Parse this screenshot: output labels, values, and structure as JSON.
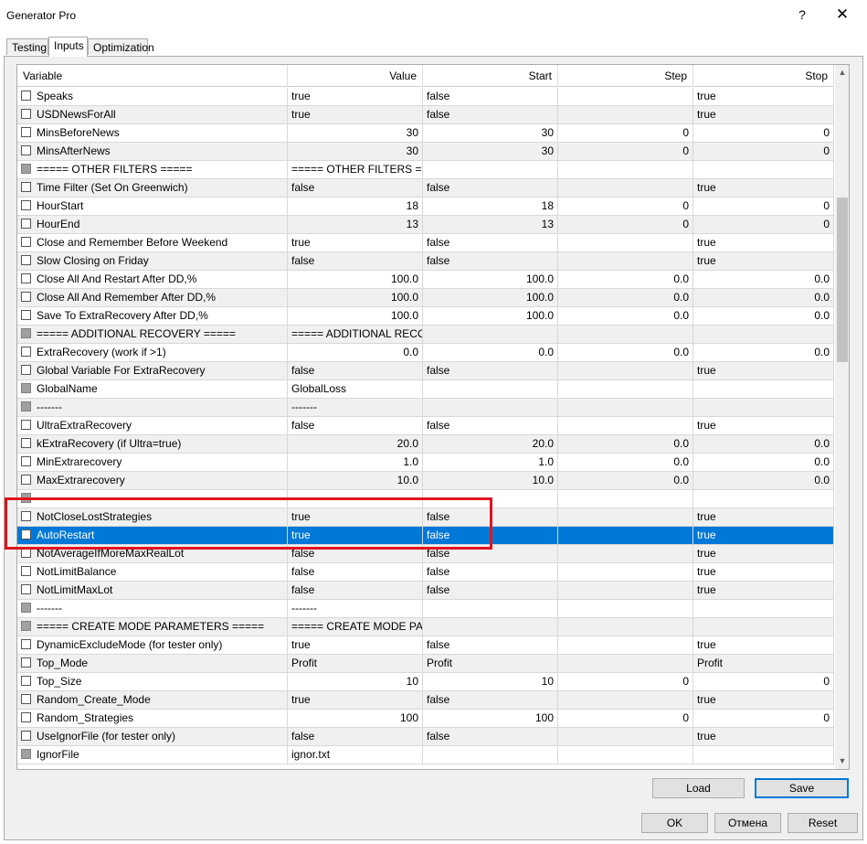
{
  "window": {
    "title": "Generator Pro",
    "help_label": "?",
    "close_label": "✕"
  },
  "tabs": [
    {
      "label": "Testing",
      "active": false
    },
    {
      "label": "Inputs",
      "active": true
    },
    {
      "label": "Optimization",
      "active": false
    }
  ],
  "grid": {
    "headers": {
      "variable": "Variable",
      "value": "Value",
      "start": "Start",
      "step": "Step",
      "stop": "Stop"
    },
    "rows": [
      {
        "name": "Speaks",
        "value": "true",
        "start": "false",
        "step": "",
        "stop": "true",
        "checkbox": "normal",
        "numeric": false
      },
      {
        "name": "USDNewsForAll",
        "value": "true",
        "start": "false",
        "step": "",
        "stop": "true",
        "checkbox": "normal",
        "numeric": false
      },
      {
        "name": "MinsBeforeNews",
        "value": "30",
        "start": "30",
        "step": "0",
        "stop": "0",
        "checkbox": "normal",
        "numeric": true
      },
      {
        "name": "MinsAfterNews",
        "value": "30",
        "start": "30",
        "step": "0",
        "stop": "0",
        "checkbox": "normal",
        "numeric": true
      },
      {
        "name": "=====     OTHER FILTERS     =====",
        "value": "=====     OTHER FILTERS     =====",
        "start": "",
        "step": "",
        "stop": "",
        "checkbox": "disabled",
        "numeric": false
      },
      {
        "name": "Time Filter (Set On Greenwich)",
        "value": "false",
        "start": "false",
        "step": "",
        "stop": "true",
        "checkbox": "normal",
        "numeric": false
      },
      {
        "name": "HourStart",
        "value": "18",
        "start": "18",
        "step": "0",
        "stop": "0",
        "checkbox": "normal",
        "numeric": true
      },
      {
        "name": "HourEnd",
        "value": "13",
        "start": "13",
        "step": "0",
        "stop": "0",
        "checkbox": "normal",
        "numeric": true
      },
      {
        "name": "Close and Remember Before Weekend",
        "value": "true",
        "start": "false",
        "step": "",
        "stop": "true",
        "checkbox": "normal",
        "numeric": false
      },
      {
        "name": "Slow Closing on Friday",
        "value": "false",
        "start": "false",
        "step": "",
        "stop": "true",
        "checkbox": "normal",
        "numeric": false
      },
      {
        "name": "Close All And Restart After DD,%",
        "value": "100.0",
        "start": "100.0",
        "step": "0.0",
        "stop": "0.0",
        "checkbox": "normal",
        "numeric": true
      },
      {
        "name": "Close All And Remember After DD,%",
        "value": "100.0",
        "start": "100.0",
        "step": "0.0",
        "stop": "0.0",
        "checkbox": "normal",
        "numeric": true
      },
      {
        "name": "Save To ExtraRecovery After DD,%",
        "value": "100.0",
        "start": "100.0",
        "step": "0.0",
        "stop": "0.0",
        "checkbox": "normal",
        "numeric": true
      },
      {
        "name": "===== ADDITIONAL RECOVERY =====",
        "value": "===== ADDITIONAL RECOVERY =====",
        "start": "",
        "step": "",
        "stop": "",
        "checkbox": "disabled",
        "numeric": false
      },
      {
        "name": "ExtraRecovery (work if >1)",
        "value": "0.0",
        "start": "0.0",
        "step": "0.0",
        "stop": "0.0",
        "checkbox": "normal",
        "numeric": true
      },
      {
        "name": "Global Variable For ExtraRecovery",
        "value": "false",
        "start": "false",
        "step": "",
        "stop": "true",
        "checkbox": "normal",
        "numeric": false
      },
      {
        "name": "GlobalName",
        "value": "GlobalLoss",
        "start": "",
        "step": "",
        "stop": "",
        "checkbox": "disabled",
        "numeric": false
      },
      {
        "name": "-------",
        "value": "-------",
        "start": "",
        "step": "",
        "stop": "",
        "checkbox": "disabled",
        "numeric": false
      },
      {
        "name": "UltraExtraRecovery",
        "value": "false",
        "start": "false",
        "step": "",
        "stop": "true",
        "checkbox": "normal",
        "numeric": false
      },
      {
        "name": "kExtraRecovery (if Ultra=true)",
        "value": "20.0",
        "start": "20.0",
        "step": "0.0",
        "stop": "0.0",
        "checkbox": "normal",
        "numeric": true
      },
      {
        "name": "MinExtrarecovery",
        "value": "1.0",
        "start": "1.0",
        "step": "0.0",
        "stop": "0.0",
        "checkbox": "normal",
        "numeric": true
      },
      {
        "name": "MaxExtrarecovery",
        "value": "10.0",
        "start": "10.0",
        "step": "0.0",
        "stop": "0.0",
        "checkbox": "normal",
        "numeric": true
      },
      {
        "name": "",
        "value": "",
        "start": "",
        "step": "",
        "stop": "",
        "checkbox": "disabled",
        "numeric": false
      },
      {
        "name": "NotCloseLostStrategies",
        "value": "true",
        "start": "false",
        "step": "",
        "stop": "true",
        "checkbox": "normal",
        "numeric": false
      },
      {
        "name": "AutoRestart",
        "value": "true",
        "start": "false",
        "step": "",
        "stop": "true",
        "checkbox": "normal",
        "numeric": false,
        "selected": true
      },
      {
        "name": "NotAverageIfMoreMaxRealLot",
        "value": "false",
        "start": "false",
        "step": "",
        "stop": "true",
        "checkbox": "normal",
        "numeric": false
      },
      {
        "name": "NotLimitBalance",
        "value": "false",
        "start": "false",
        "step": "",
        "stop": "true",
        "checkbox": "normal",
        "numeric": false
      },
      {
        "name": "NotLimitMaxLot",
        "value": "false",
        "start": "false",
        "step": "",
        "stop": "true",
        "checkbox": "normal",
        "numeric": false
      },
      {
        "name": "-------",
        "value": "-------",
        "start": "",
        "step": "",
        "stop": "",
        "checkbox": "disabled",
        "numeric": false
      },
      {
        "name": "===== CREATE MODE PARAMETERS =====",
        "value": "===== CREATE MODE PARAMETERS =====",
        "start": "",
        "step": "",
        "stop": "",
        "checkbox": "disabled",
        "numeric": false
      },
      {
        "name": "DynamicExcludeMode (for tester only)",
        "value": "true",
        "start": "false",
        "step": "",
        "stop": "true",
        "checkbox": "normal",
        "numeric": false
      },
      {
        "name": "Top_Mode",
        "value": "Profit",
        "start": "Profit",
        "step": "",
        "stop": "Profit",
        "checkbox": "normal",
        "numeric": false
      },
      {
        "name": "Top_Size",
        "value": "10",
        "start": "10",
        "step": "0",
        "stop": "0",
        "checkbox": "normal",
        "numeric": true
      },
      {
        "name": "Random_Create_Mode",
        "value": "true",
        "start": "false",
        "step": "",
        "stop": "true",
        "checkbox": "normal",
        "numeric": false
      },
      {
        "name": "Random_Strategies",
        "value": "100",
        "start": "100",
        "step": "0",
        "stop": "0",
        "checkbox": "normal",
        "numeric": true
      },
      {
        "name": "UseIgnorFile (for tester only)",
        "value": "false",
        "start": "false",
        "step": "",
        "stop": "true",
        "checkbox": "normal",
        "numeric": false
      },
      {
        "name": "IgnorFile",
        "value": "ignor.txt",
        "start": "",
        "step": "",
        "stop": "",
        "checkbox": "disabled",
        "numeric": false
      }
    ]
  },
  "buttons": {
    "load": "Load",
    "save": "Save",
    "ok": "OK",
    "cancel": "Отмена",
    "reset": "Reset"
  },
  "colors": {
    "selection": "#0078d7",
    "highlight_box": "#e0141e",
    "alt_row": "#f0f0f0"
  }
}
